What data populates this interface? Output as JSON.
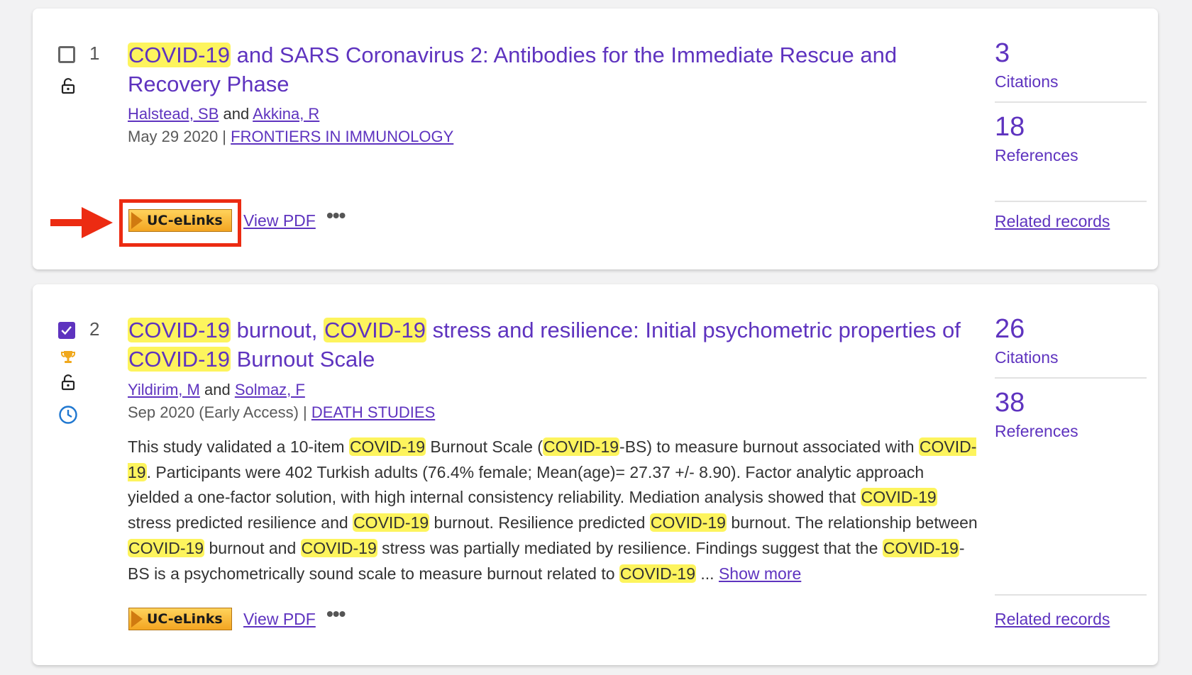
{
  "results": [
    {
      "number": "1",
      "checked": false,
      "title": {
        "segments": [
          {
            "text": "COVID-19",
            "highlight": true
          },
          {
            "text": " and SARS Coronavirus 2: Antibodies for the Immediate Rescue and Recovery Phase",
            "highlight": false
          }
        ]
      },
      "authors": [
        "Halstead, SB",
        "Akkina, R"
      ],
      "authors_joiner": "and",
      "date": "May 29 2020 |",
      "journal": "FRONTIERS IN IMMUNOLOGY",
      "uc_elinks_label": "UC-eLinks",
      "view_pdf_label": "View PDF",
      "more_label": "•••",
      "citations_count": "3",
      "citations_label": "Citations",
      "references_count": "18",
      "references_label": "References",
      "related_label": "Related records",
      "icons": [
        "lock-open-icon"
      ]
    },
    {
      "number": "2",
      "checked": true,
      "title": {
        "segments": [
          {
            "text": "COVID-19",
            "highlight": true
          },
          {
            "text": " burnout, ",
            "highlight": false
          },
          {
            "text": "COVID-19",
            "highlight": true
          },
          {
            "text": " stress and resilience: Initial psychometric properties of ",
            "highlight": false
          },
          {
            "text": "COVID-19",
            "highlight": true
          },
          {
            "text": " Burnout Scale",
            "highlight": false
          }
        ]
      },
      "authors": [
        "Yildirim, M",
        "Solmaz, F"
      ],
      "authors_joiner": "and",
      "date": "Sep 2020 (Early Access) |",
      "journal": "DEATH STUDIES",
      "abstract": {
        "segments": [
          {
            "text": "This study validated a 10-item ",
            "highlight": false
          },
          {
            "text": "COVID-19",
            "highlight": true
          },
          {
            "text": " Burnout Scale (",
            "highlight": false
          },
          {
            "text": "COVID-19",
            "highlight": true
          },
          {
            "text": "-BS) to measure burnout associated with ",
            "highlight": false
          },
          {
            "text": "COVID-19",
            "highlight": true
          },
          {
            "text": ". Participants were 402 Turkish adults (76.4% female; Mean(age)= 27.37 +/- 8.90). Factor analytic approach yielded a one-factor solution, with high internal consistency reliability. Mediation analysis showed that ",
            "highlight": false
          },
          {
            "text": "COVID-19",
            "highlight": true
          },
          {
            "text": " stress predicted resilience and ",
            "highlight": false
          },
          {
            "text": "COVID-19",
            "highlight": true
          },
          {
            "text": " burnout. Resilience predicted ",
            "highlight": false
          },
          {
            "text": "COVID-19",
            "highlight": true
          },
          {
            "text": " burnout. The relationship between ",
            "highlight": false
          },
          {
            "text": "COVID-19",
            "highlight": true
          },
          {
            "text": " burnout and ",
            "highlight": false
          },
          {
            "text": "COVID-19",
            "highlight": true
          },
          {
            "text": " stress was partially mediated by resilience. Findings suggest that the ",
            "highlight": false
          },
          {
            "text": "COVID-19",
            "highlight": true
          },
          {
            "text": "-BS is a psychometrically sound scale to measure burnout related to ",
            "highlight": false
          },
          {
            "text": "COVID-19",
            "highlight": true
          },
          {
            "text": " ... ",
            "highlight": false
          }
        ],
        "show_more_label": "Show more"
      },
      "uc_elinks_label": "UC-eLinks",
      "view_pdf_label": "View PDF",
      "more_label": "•••",
      "citations_count": "26",
      "citations_label": "Citations",
      "references_count": "38",
      "references_label": "References",
      "related_label": "Related records",
      "icons": [
        "trophy-icon",
        "lock-open-icon",
        "clock-icon"
      ]
    }
  ],
  "colors": {
    "accent": "#5e33bf",
    "highlight": "#fdf45d",
    "annotation": "#ec2b12",
    "uc_button": "#f3a521"
  }
}
